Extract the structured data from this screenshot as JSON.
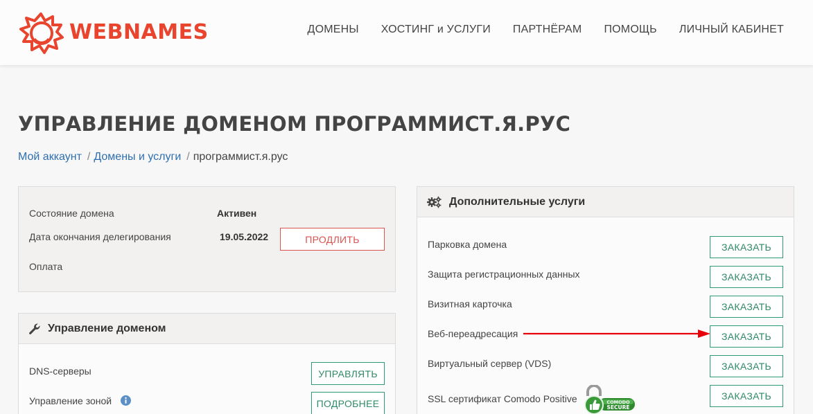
{
  "logo": {
    "text": "WEBNAMES"
  },
  "nav": [
    {
      "label": "ДОМЕНЫ"
    },
    {
      "label": "ХОСТИНГ и УСЛУГИ"
    },
    {
      "label": "ПАРТНЁРАМ"
    },
    {
      "label": "ПОМОЩЬ"
    },
    {
      "label": "ЛИЧНЫЙ КАБИНЕТ"
    }
  ],
  "page": {
    "title": "УПРАВЛЕНИЕ ДОМЕНОМ ПРОГРАММИСТ.Я.РУС"
  },
  "breadcrumb": {
    "items": [
      "Мой аккаунт",
      "Домены и услуги"
    ],
    "separator": "/",
    "current": "программист.я.рус"
  },
  "status_panel": {
    "state_label": "Состояние домена",
    "state_value": "Активен",
    "expiry_label": "Дата окончания делегирования",
    "expiry_value": "19.05.2022",
    "renew_button": "ПРОДЛИТЬ",
    "payment_label": "Оплата"
  },
  "manage_panel": {
    "title": "Управление доменом",
    "icon": "wrench-icon",
    "dns_label": "DNS-серверы",
    "dns_button": "УПРАВЛЯТЬ",
    "zone_label": "Управление зоной",
    "zone_button": "ПОДРОБНЕЕ"
  },
  "services_panel": {
    "title": "Дополнительные услуги",
    "icon": "gears-icon",
    "items": [
      {
        "label": "Парковка домена",
        "button": "ЗАКАЗАТЬ"
      },
      {
        "label": "Защита регистрационных данных",
        "button": "ЗАКАЗАТЬ"
      },
      {
        "label": "Визитная карточка",
        "button": "ЗАКАЗАТЬ"
      },
      {
        "label": "Веб-переадресация",
        "button": "ЗАКАЗАТЬ"
      },
      {
        "label": "Виртуальный сервер (VDS)",
        "button": "ЗАКАЗАТЬ"
      },
      {
        "label": "SSL сертификат Comodo Positive",
        "button": "ЗАКАЗАТЬ"
      }
    ],
    "ssl_badge": {
      "line1": "COMODO",
      "line2": "SECURE"
    }
  },
  "colors": {
    "brand": "#e8442e",
    "link": "#2e6fb0",
    "renew_border": "#d9534f",
    "order_border": "#2e9a72",
    "arrow": "#e8000a"
  }
}
